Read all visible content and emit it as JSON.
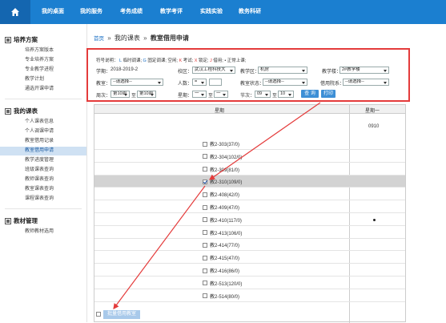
{
  "nav": {
    "items": [
      "我的桌面",
      "我的服务",
      "考务成绩",
      "教学考评",
      "实践实验",
      "教务科研"
    ]
  },
  "sidebar": {
    "sections": [
      {
        "title": "培养方案",
        "items": [
          "培养方案版本",
          "专业培养方案",
          "专业教学进程",
          "教学计划",
          "通选开课申请"
        ]
      },
      {
        "title": "我的课表",
        "items": [
          "个人课表信息",
          "个人调课申请",
          "教室借用记录",
          "教室借用申请",
          "教学进度管理",
          "班级课表查询",
          "教师课表查询",
          "教室课表查询",
          "课程课表查询"
        ]
      },
      {
        "title": "教材管理",
        "items": [
          "教师教材选用"
        ]
      }
    ]
  },
  "breadcrumb": {
    "home": "首页",
    "sep": "»",
    "parent": "我的课表",
    "current": "教室借用申请"
  },
  "legend": {
    "prefix": "符号说明：",
    "l_key": "L",
    "l_text": "临时调课;",
    "g_key": "G",
    "g_text": "固定调课;",
    "empty": "空闲;",
    "k_key": "K",
    "k_text": "考试;",
    "x_key": "X",
    "x_text": "锁定;",
    "j_key": "J",
    "j_text": "借用;",
    "dot": "• 正常上课;"
  },
  "filters": {
    "term_label": "学期：",
    "term_value": "2018-2019-2",
    "campus_label": "校区：",
    "campus_value": "武汉工程科技大",
    "building_area_label": "教学区：",
    "building_area_value": "机房",
    "building_label": "教学楼：",
    "building_value": "2#教学楼",
    "room_label": "教室：",
    "room_value": "--请选择--",
    "people_label": "人数：",
    "people_op": "=",
    "people_value": "",
    "room_status_label": "教室状态：",
    "room_status_value": "--请选择--",
    "dept_label": "借用院系：",
    "dept_value": "--请选择--",
    "week_label": "周次：",
    "week_from": "第10周",
    "week_to_label": "至",
    "week_to": "第10周",
    "weekday_label": "星期：",
    "weekday_from": "一",
    "weekday_to_label": "至",
    "weekday_to": "一",
    "section_label": "节次：",
    "section_from": "09",
    "section_to_label": "至",
    "section_to": "10",
    "query_button": "查 询",
    "print_button": "打印"
  },
  "table": {
    "header_col1": "星期",
    "header_col2": "星期一",
    "time_label": "0910",
    "rooms": [
      {
        "name": "教2-303(37/0)",
        "checked": false
      },
      {
        "name": "教2-304(102/0)",
        "checked": false
      },
      {
        "name": "教2-309(81/0)",
        "checked": false
      },
      {
        "name": "教2-310(109/0)",
        "checked": true
      },
      {
        "name": "教2-408(42/0)",
        "checked": false
      },
      {
        "name": "教2-409(47/0)",
        "checked": false
      },
      {
        "name": "教2-410(117/0)",
        "checked": false
      },
      {
        "name": "教2-413(106/0)",
        "checked": false
      },
      {
        "name": "教2-414(77/0)",
        "checked": false
      },
      {
        "name": "教2-415(47/0)",
        "checked": false
      },
      {
        "name": "教2-416(86/0)",
        "checked": false
      },
      {
        "name": "教2-513(120/0)",
        "checked": false
      },
      {
        "name": "教2-514(80/0)",
        "checked": false
      }
    ],
    "batch_button": "批量借用教室"
  },
  "colors": {
    "nav": "#1b7fd0",
    "annotation": "#e43b3b",
    "highlight_row": "#d3d3d3",
    "button": "#3d8fd6"
  }
}
